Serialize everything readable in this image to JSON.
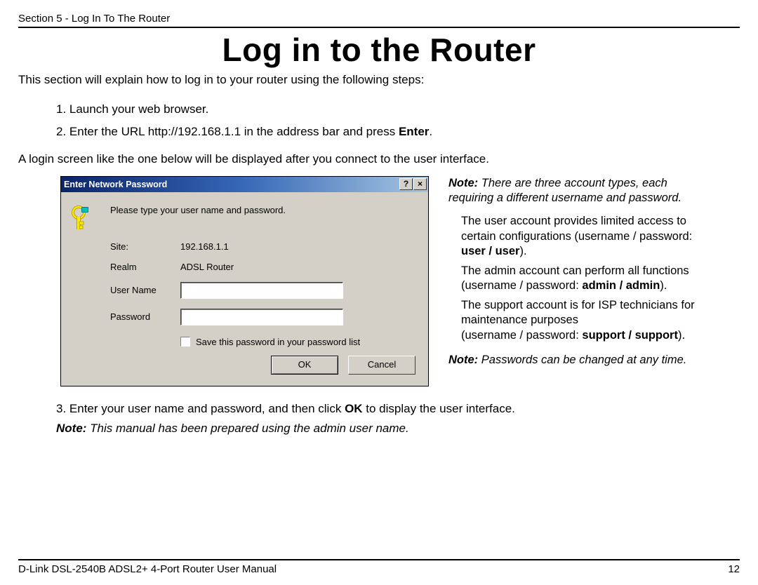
{
  "header": "Section 5 - Log In To The Router",
  "page_title": "Log in to the Router",
  "intro": "This section will explain how to log in to your router using the following steps:",
  "steps": {
    "s1": "1. Launch your web browser.",
    "s2a": "2. Enter the URL http://192.168.1.1 in the address bar and press ",
    "s2b": "Enter",
    "s2c": "."
  },
  "para2": "A login screen like the one below will be displayed after you connect to the user interface.",
  "dialog": {
    "title": "Enter Network Password",
    "prompt": "Please type your user name and password.",
    "site_label": "Site:",
    "site_value": "192.168.1.1",
    "realm_label": "Realm",
    "realm_value": "ADSL Router",
    "user_label": "User Name",
    "pass_label": "Password",
    "save_label": "Save this password in your password list",
    "ok": "OK",
    "cancel": "Cancel",
    "help_glyph": "?",
    "close_glyph": "×"
  },
  "side": {
    "note1_label": "Note:",
    "note1_text": " There are three account types, each requiring a different username and password.",
    "user_a": "The user account provides limited access to certain conﬁgurations (username / password: ",
    "user_b": "user / user",
    "user_c": ").",
    "admin_a": "The admin account can perform all functions (username / password: ",
    "admin_b": "admin / admin",
    "admin_c": ").",
    "support_a": "The support account is for ISP technicians for maintenance purposes",
    "support_b": "(username / password: ",
    "support_c": "support / support",
    "support_d": ").",
    "note2_label": "Note:",
    "note2_text": " Passwords can be changed at any time."
  },
  "step3": {
    "a": "3. Enter your user name and password, and then click ",
    "b": "OK",
    "c": " to display the user interface."
  },
  "bottom_note": {
    "label": "Note:",
    "text": " This manual has been prepared using the admin user name."
  },
  "footer": {
    "left": "D-Link DSL-2540B ADSL2+ 4-Port Router User Manual",
    "right": "12"
  }
}
